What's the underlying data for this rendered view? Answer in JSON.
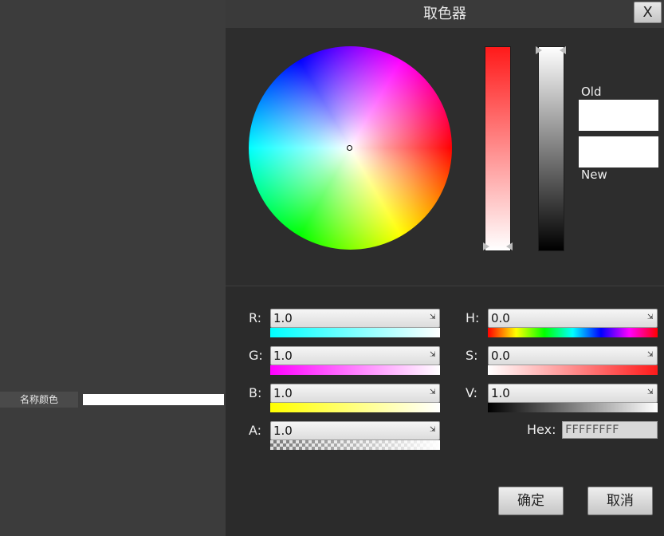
{
  "left_panel": {
    "property_label": "名称颜色",
    "property_color": "#ffffff"
  },
  "dialog": {
    "title": "取色器",
    "close_label": "X",
    "old_label": "Old",
    "new_label": "New",
    "old_color": "#ffffff",
    "new_color": "#ffffff",
    "saturation_level": 0.0,
    "value_level": 1.0
  },
  "channels": {
    "r": {
      "label": "R:",
      "value": "1.0"
    },
    "g": {
      "label": "G:",
      "value": "1.0"
    },
    "b": {
      "label": "B:",
      "value": "1.0"
    },
    "a": {
      "label": "A:",
      "value": "1.0"
    },
    "h": {
      "label": "H:",
      "value": "0.0"
    },
    "s": {
      "label": "S:",
      "value": "0.0"
    },
    "v": {
      "label": "V:",
      "value": "1.0"
    }
  },
  "hex": {
    "label": "Hex:",
    "value": "FFFFFFFF"
  },
  "buttons": {
    "ok": "确定",
    "cancel": "取消"
  },
  "icons": {
    "spin_arrow": "resize-arrow-icon"
  }
}
